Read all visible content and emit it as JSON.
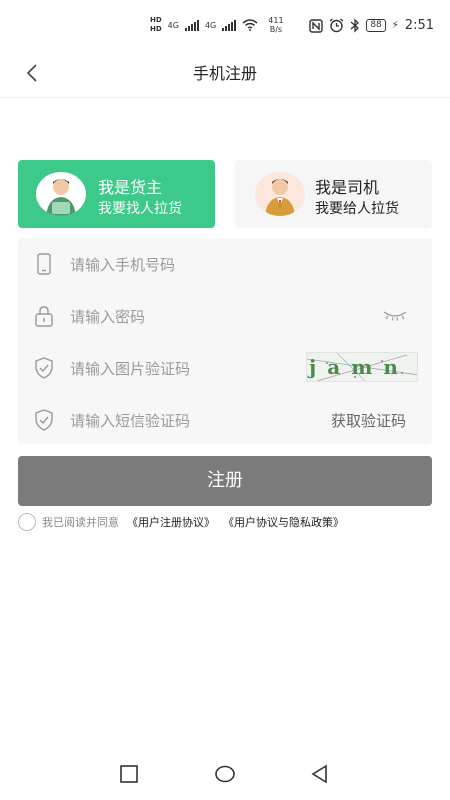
{
  "status_bar": {
    "hd1": "HD",
    "hd2": "HD",
    "net1": "4G",
    "net2": "4G",
    "speed_value": "411",
    "speed_unit": "B/s",
    "battery": "88",
    "time": "2:51"
  },
  "header": {
    "title": "手机注册"
  },
  "roles": [
    {
      "title": "我是货主",
      "subtitle": "我要找人拉货",
      "active": true
    },
    {
      "title": "我是司机",
      "subtitle": "我要给人拉货",
      "active": false
    }
  ],
  "form": {
    "phone_placeholder": "请输入手机号码",
    "password_placeholder": "请输入密码",
    "captcha_placeholder": "请输入图片验证码",
    "captcha_text": "jamn",
    "sms_placeholder": "请输入短信验证码",
    "get_code": "获取验证码"
  },
  "register_button": "注册",
  "agreement": {
    "prefix": "我已阅读并同意",
    "link1": "《用户注册协议》",
    "link2": "《用户协议与隐私政策》"
  },
  "colors": {
    "accent": "#3dc98a",
    "button_disabled": "#7b7b7b",
    "form_bg": "#f7f7f7"
  }
}
